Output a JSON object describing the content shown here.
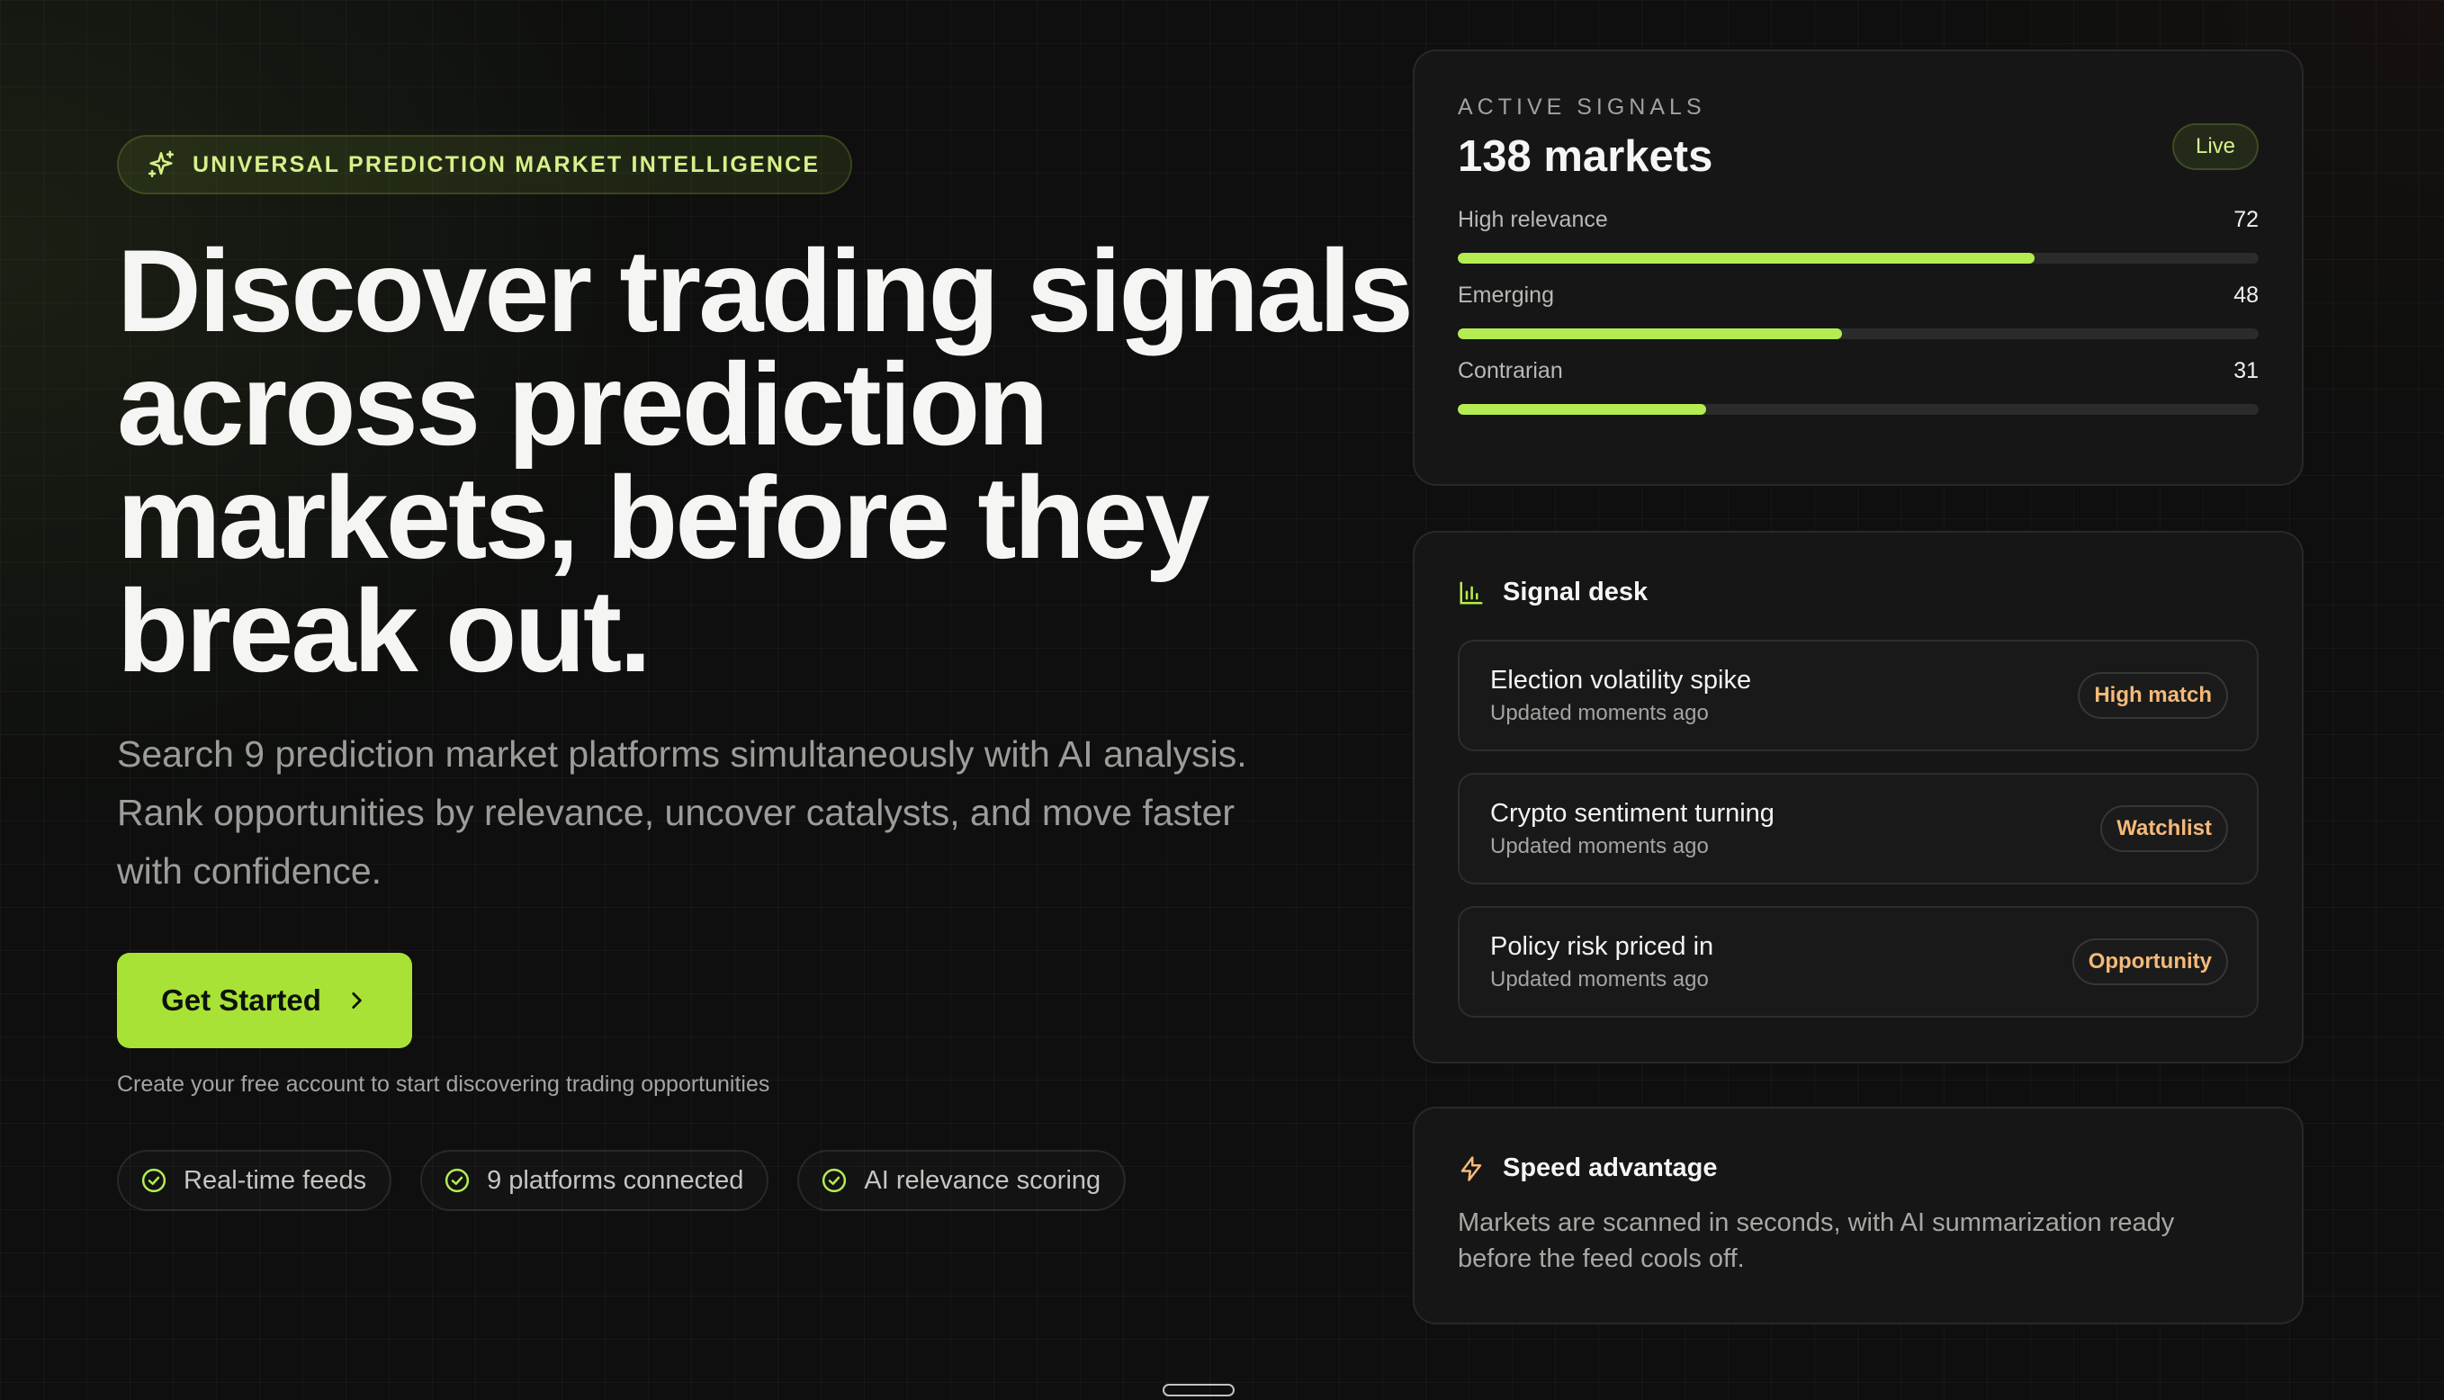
{
  "hero": {
    "eyebrow": "UNIVERSAL PREDICTION MARKET INTELLIGENCE",
    "eyebrow_icon": "sparkles-icon",
    "headline_lines": [
      "Discover trading signals",
      "across prediction",
      "markets, before they",
      "break out."
    ],
    "lede_lines": [
      "Search 9 prediction market platforms simultaneously with AI analysis.",
      "Rank opportunities by relevance, uncover catalysts, and move faster",
      "with confidence."
    ],
    "cta_label": "Get Started",
    "cta_icon": "chevron-right-icon",
    "cta_note": "Create your free account to start discovering trading opportunities",
    "features": [
      {
        "label": "Real-time feeds",
        "icon": "check-circle-icon"
      },
      {
        "label": "9 platforms connected",
        "icon": "check-circle-icon"
      },
      {
        "label": "AI relevance scoring",
        "icon": "check-circle-icon"
      }
    ]
  },
  "signals": {
    "kicker": "ACTIVE SIGNALS",
    "count": "138 markets",
    "status_badge": "Live",
    "meters": [
      {
        "label": "High relevance",
        "value": "72",
        "fill_fraction": 0.72
      },
      {
        "label": "Emerging",
        "value": "48",
        "fill_fraction": 0.48
      },
      {
        "label": "Contrarian",
        "value": "31",
        "fill_fraction": 0.31
      }
    ]
  },
  "desk": {
    "title": "Signal desk",
    "icon": "bar-chart-icon",
    "items": [
      {
        "name": "Election volatility spike",
        "sub": "Updated moments ago",
        "tag": "High match"
      },
      {
        "name": "Crypto sentiment turning",
        "sub": "Updated moments ago",
        "tag": "Watchlist"
      },
      {
        "name": "Policy risk priced in",
        "sub": "Updated moments ago",
        "tag": "Opportunity"
      }
    ]
  },
  "speed": {
    "title": "Speed advantage",
    "icon": "lightning-icon",
    "text_lines": [
      "Markets are scanned in seconds, with AI summarization ready",
      "before the feed cools off."
    ]
  },
  "colors": {
    "accent": "#a8e236",
    "accent_text": "#d7f08a",
    "tag_text": "#f5b97a",
    "background": "#0e0f0e"
  }
}
